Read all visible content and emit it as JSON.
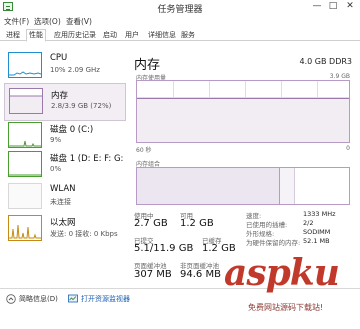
{
  "window": {
    "title": "任务管理器",
    "buttons": {
      "minimize": "—",
      "maximize": "□",
      "close": "✕"
    }
  },
  "menu": [
    "文件(F)",
    "选项(O)",
    "查看(V)"
  ],
  "tabs": [
    "进程",
    "性能",
    "应用历史记录",
    "启动",
    "用户",
    "详细信息",
    "服务"
  ],
  "active_tab": "性能",
  "sidebar": [
    {
      "name": "CPU",
      "detail": "10% 2.09 GHz"
    },
    {
      "name": "内存",
      "detail": "2.8/3.9 GB (72%)"
    },
    {
      "name": "磁盘 0 (C:)",
      "detail": "9%"
    },
    {
      "name": "磁盘 1 (D: E: F: G:",
      "detail": "0%"
    },
    {
      "name": "WLAN",
      "detail": "未连接"
    },
    {
      "name": "以太网",
      "detail": "发送: 0 接收: 0 Kbps"
    }
  ],
  "panel": {
    "title": "内存",
    "spec": "4.0 GB DDR3",
    "graph_label": "内存使用量",
    "graph_max": "3.9 GB",
    "graph_time_left": "60 秒",
    "graph_time_right": "0",
    "composition_label": "内存组合",
    "usage_fraction": 0.72,
    "stats": {
      "in_use_label": "使用中",
      "in_use_value": "2.7 GB",
      "available_label": "可用",
      "available_value": "1.2 GB",
      "committed_label": "已提交",
      "committed_value": "5.1/11.9 GB",
      "cached_label": "已缓存",
      "cached_value": "1.2 GB",
      "paged_pool_label": "页面缓冲池",
      "paged_pool_value": "307 MB",
      "nonpaged_pool_label": "非页面缓冲池",
      "nonpaged_pool_value": "94.6 MB"
    },
    "specs": [
      {
        "key": "速度:",
        "value": "1333 MHz"
      },
      {
        "key": "已使用的插槽:",
        "value": "2/2"
      },
      {
        "key": "外形规格:",
        "value": "SODIMM"
      },
      {
        "key": "为硬件保留的内存:",
        "value": "52.1 MB"
      }
    ]
  },
  "bottom": {
    "less_details": "简略信息(D)",
    "open_monitor": "打开资源监视器"
  },
  "watermark": {
    "brand": "aspku",
    "subtitle": "免费网站源码下载站!"
  },
  "colors": {
    "memory_accent": "#9b79ad",
    "cpu_accent": "#1f8fd1",
    "disk_accent": "#4a9d2f",
    "ethernet_accent": "#c58a12",
    "link": "#1a5fb4"
  }
}
